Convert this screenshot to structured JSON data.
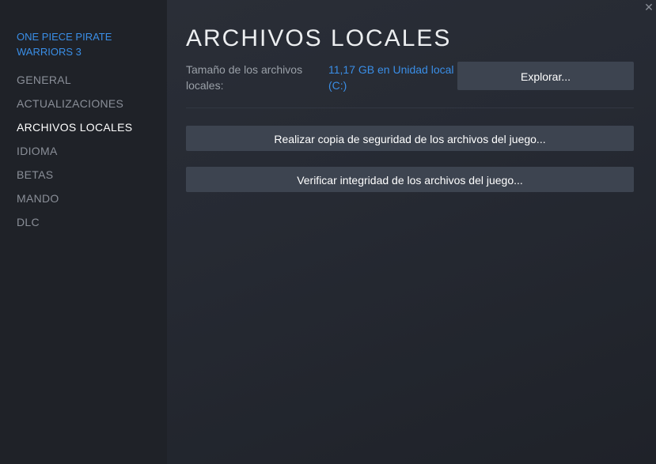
{
  "window": {
    "close_glyph": "✕"
  },
  "sidebar": {
    "game_title": "ONE PIECE PIRATE WARRIORS 3",
    "items": [
      {
        "label": "GENERAL",
        "active": false
      },
      {
        "label": "ACTUALIZACIONES",
        "active": false
      },
      {
        "label": "ARCHIVOS LOCALES",
        "active": true
      },
      {
        "label": "IDIOMA",
        "active": false
      },
      {
        "label": "BETAS",
        "active": false
      },
      {
        "label": "MANDO",
        "active": false
      },
      {
        "label": "DLC",
        "active": false
      }
    ]
  },
  "main": {
    "title": "ARCHIVOS LOCALES",
    "size_label": "Tamaño de los archivos locales:",
    "size_value": "11,17 GB en Unidad local (C:)",
    "explore_label": "Explorar...",
    "backup_label": "Realizar copia de seguridad de los archivos del juego...",
    "verify_label": "Verificar integridad de los archivos del juego..."
  },
  "colors": {
    "accent": "#3a8ee6",
    "sidebar_bg": "#1f2228",
    "button_bg": "#3d4450"
  }
}
